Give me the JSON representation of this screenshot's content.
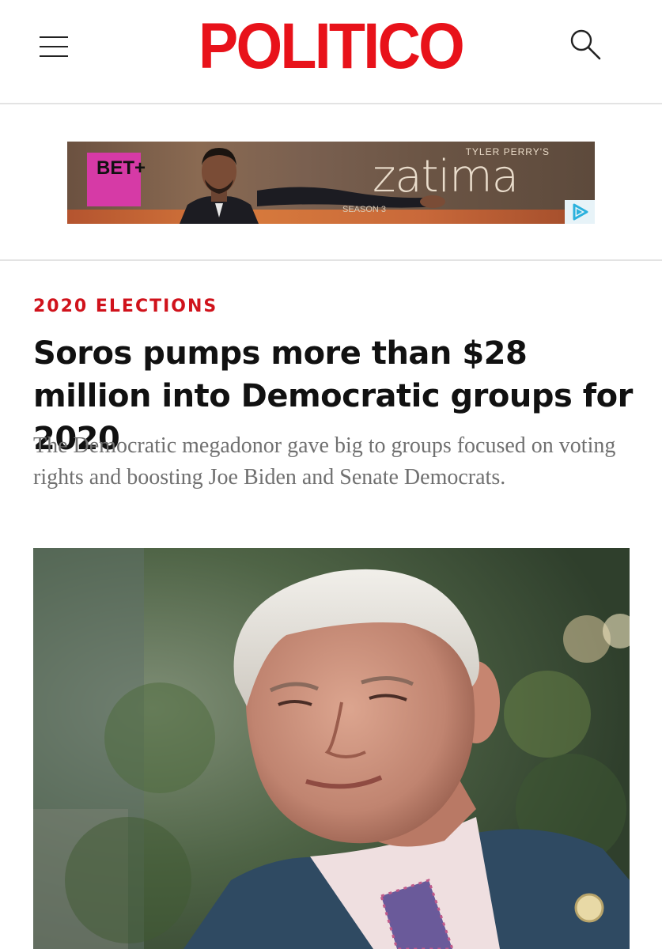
{
  "header": {
    "logo_text": "POLITICO",
    "menu_icon": "hamburger-menu-icon",
    "search_icon": "search-icon",
    "brand_color": "#e8121a"
  },
  "ad": {
    "network_logo": "BET+",
    "presenter": "TYLER PERRY'S",
    "title": "zatima",
    "season": "SEASON 3",
    "choice_icon": "adchoices-icon"
  },
  "article": {
    "kicker": "2020 ELECTIONS",
    "kicker_color": "#d0121b",
    "headline": "Soros pumps more than $28 million into Democratic groups for 2020",
    "dek": "The Democratic megadonor gave big to groups focused on voting rights and boosting Joe Biden and Senate Democrats."
  }
}
